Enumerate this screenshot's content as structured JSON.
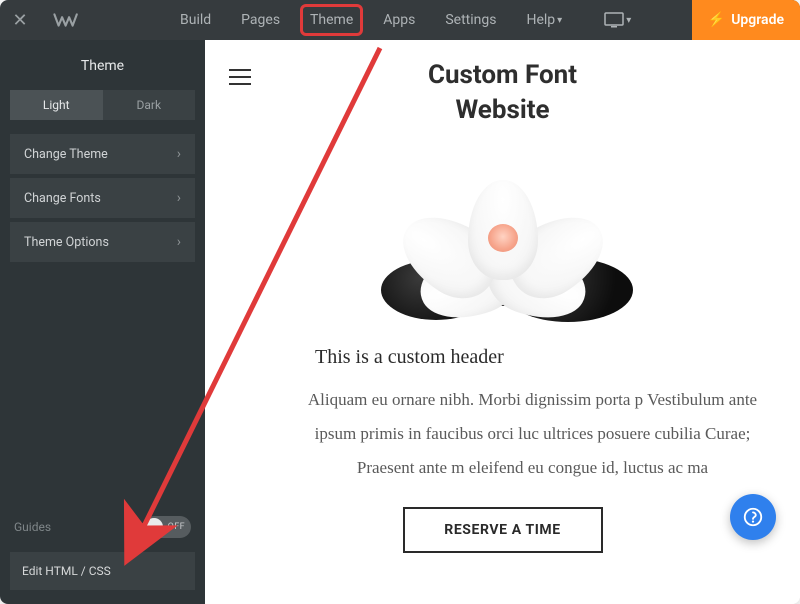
{
  "topbar": {
    "nav": [
      "Build",
      "Pages",
      "Theme",
      "Apps",
      "Settings"
    ],
    "help_label": "Help",
    "upgrade_label": "Upgrade",
    "active_nav_index": 2
  },
  "sidebar": {
    "title": "Theme",
    "tabs": {
      "light": "Light",
      "dark": "Dark"
    },
    "items": [
      {
        "label": "Change Theme"
      },
      {
        "label": "Change Fonts"
      },
      {
        "label": "Theme Options"
      }
    ],
    "guides_label": "Guides",
    "guides_toggle": "OFF",
    "edit_label": "Edit HTML / CSS"
  },
  "canvas": {
    "site_title_line1": "Custom Font",
    "site_title_line2": "Website",
    "custom_header": "This is a custom header",
    "paragraph": "Aliquam eu ornare nibh. Morbi dignissim porta p       Vestibulum ante ipsum primis in faucibus orci luc       ultrices posuere cubilia Curae; Praesent ante m            eleifend eu congue id, luctus ac ma",
    "cta_label": "RESERVE A TIME"
  },
  "annotation": {
    "highlight_target": "Theme",
    "arrow_points_to": "Edit HTML / CSS"
  }
}
